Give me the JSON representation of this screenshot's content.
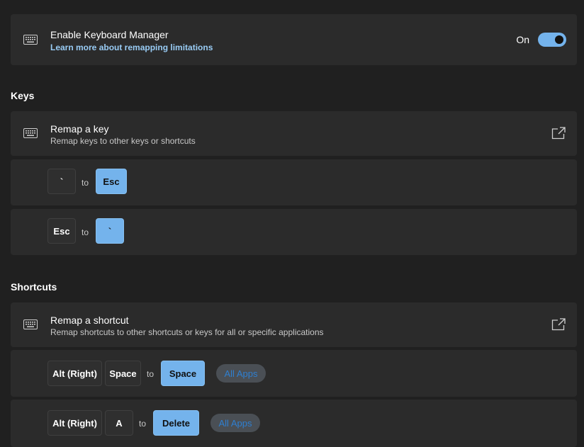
{
  "enable": {
    "title": "Enable Keyboard Manager",
    "link": "Learn more about remapping limitations",
    "toggle_label": "On",
    "toggle_on": true,
    "icon": "keyboard-icon"
  },
  "keys_section": {
    "header": "Keys",
    "card": {
      "title": "Remap a key",
      "subtitle": "Remap keys to other keys or shortcuts",
      "icon": "keyboard-icon",
      "action_icon": "open-external-icon"
    },
    "remaps": [
      {
        "from": "`",
        "to_word": "to",
        "to": "Esc"
      },
      {
        "from": "Esc",
        "to_word": "to",
        "to": "`"
      }
    ]
  },
  "shortcuts_section": {
    "header": "Shortcuts",
    "card": {
      "title": "Remap a shortcut",
      "subtitle": "Remap shortcuts to other shortcuts or keys for all or specific applications",
      "icon": "keyboard-icon",
      "action_icon": "open-external-icon"
    },
    "remaps": [
      {
        "from": [
          "Alt (Right)",
          "Space"
        ],
        "to_word": "to",
        "to": "Space",
        "apps": "All Apps"
      },
      {
        "from": [
          "Alt (Right)",
          "A"
        ],
        "to_word": "to",
        "to": "Delete",
        "apps": "All Apps"
      }
    ]
  },
  "colors": {
    "background": "#202020",
    "card": "#2b2b2b",
    "accent": "#74b3ec",
    "link": "#99ccf5"
  }
}
